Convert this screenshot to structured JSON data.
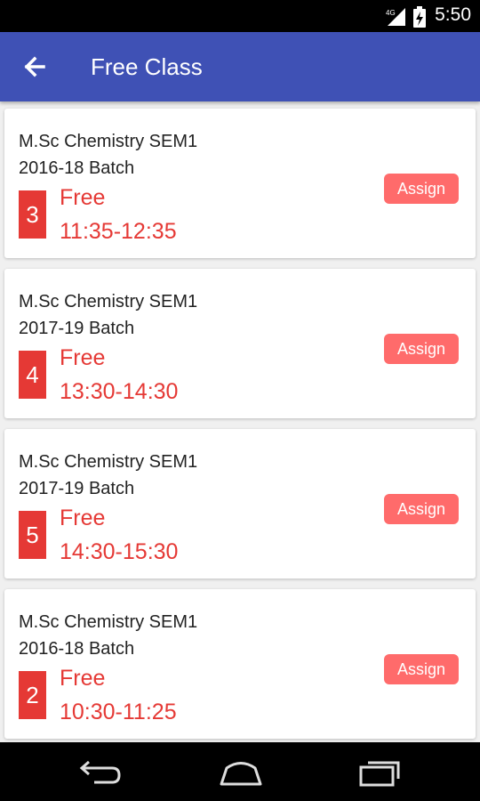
{
  "status_bar": {
    "time": "5:50",
    "network": "4G"
  },
  "app_bar": {
    "title": "Free Class"
  },
  "items": [
    {
      "course": "M.Sc Chemistry SEM1",
      "batch": "2016-18 Batch",
      "period": "3",
      "status": "Free",
      "time": "11:35-12:35",
      "action": "Assign"
    },
    {
      "course": "M.Sc Chemistry SEM1",
      "batch": "2017-19 Batch",
      "period": "4",
      "status": "Free",
      "time": "13:30-14:30",
      "action": "Assign"
    },
    {
      "course": "M.Sc Chemistry SEM1",
      "batch": "2017-19 Batch",
      "period": "5",
      "status": "Free",
      "time": "14:30-15:30",
      "action": "Assign"
    },
    {
      "course": "M.Sc Chemistry SEM1",
      "batch": "2016-18 Batch",
      "period": "2",
      "status": "Free",
      "time": "10:30-11:25",
      "action": "Assign"
    }
  ],
  "colors": {
    "primary": "#3f51b5",
    "accent_red": "#e53935",
    "assign_button": "#ff6b6b"
  },
  "icons": {
    "back": "arrow-left-icon",
    "nav_back": "back-icon",
    "nav_home": "home-icon",
    "nav_recents": "recents-icon"
  }
}
